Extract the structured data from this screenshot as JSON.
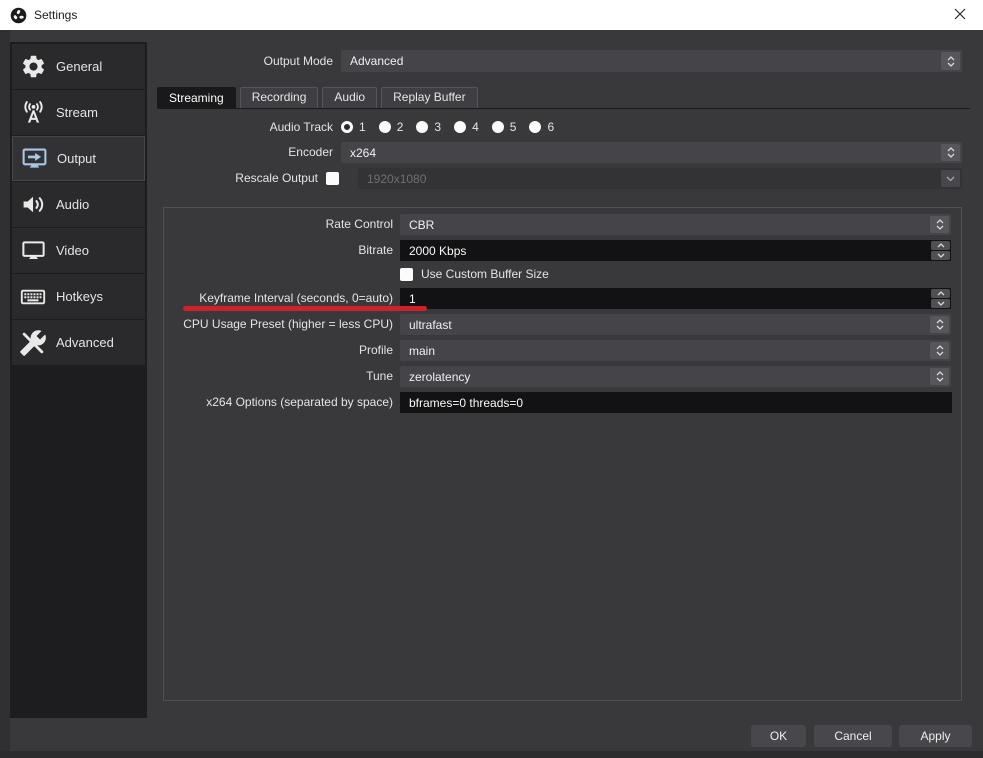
{
  "win": {
    "title": "Settings"
  },
  "sidebar": {
    "selected": "Output",
    "items": [
      {
        "label": "General",
        "icon": "gear-icon"
      },
      {
        "label": "Stream",
        "icon": "broadcast-icon"
      },
      {
        "label": "Output",
        "icon": "monitor-arrow-icon"
      },
      {
        "label": "Audio",
        "icon": "speaker-icon"
      },
      {
        "label": "Video",
        "icon": "display-icon"
      },
      {
        "label": "Hotkeys",
        "icon": "keyboard-icon"
      },
      {
        "label": "Advanced",
        "icon": "crossed-tools-icon"
      }
    ]
  },
  "main": {
    "output_mode": {
      "label": "Output Mode",
      "value": "Advanced"
    },
    "tabs": [
      "Streaming",
      "Recording",
      "Audio",
      "Replay Buffer"
    ],
    "selected_tab": "Streaming",
    "audio_track": {
      "label": "Audio Track",
      "options": [
        "1",
        "2",
        "3",
        "4",
        "5",
        "6"
      ],
      "selected": "1"
    },
    "encoder": {
      "label": "Encoder",
      "value": "x264"
    },
    "rescale": {
      "label": "Rescale Output",
      "value": "1920x1080",
      "checked": false,
      "enabled": false
    }
  },
  "group": {
    "rate_control": {
      "label": "Rate Control",
      "value": "CBR"
    },
    "bitrate": {
      "label": "Bitrate",
      "value": "2000 Kbps"
    },
    "custom_buffer": {
      "label": "Use Custom Buffer Size",
      "checked": false
    },
    "keyframe": {
      "label": "Keyframe Interval (seconds, 0=auto)",
      "value": "1",
      "annotated": true
    },
    "cpu_preset": {
      "label": "CPU Usage Preset (higher = less CPU)",
      "value": "ultrafast"
    },
    "profile": {
      "label": "Profile",
      "value": "main"
    },
    "tune": {
      "label": "Tune",
      "value": "zerolatency"
    },
    "x264_options": {
      "label": "x264 Options (separated by space)",
      "value": "bframes=0 threads=0"
    }
  },
  "footer": {
    "ok": "OK",
    "cancel": "Cancel",
    "apply": "Apply"
  },
  "colors": {
    "annotation_red": "#cf2127",
    "selected_icon_blue": "#a9c7e8",
    "titlebar_bg": "#ffffff",
    "dialog_bg": "#39393b",
    "field_dark_bg": "#121214",
    "combo_bg": "#454549"
  }
}
